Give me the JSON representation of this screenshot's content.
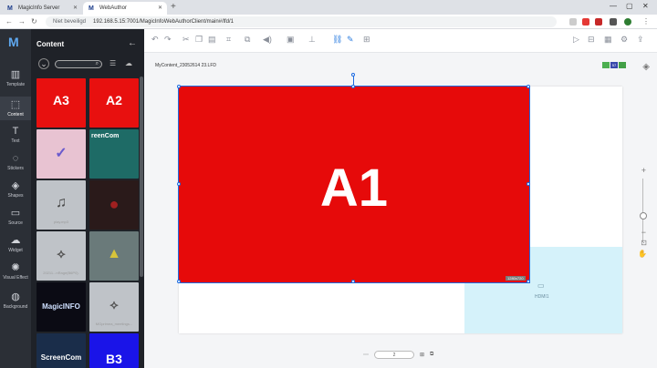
{
  "browser": {
    "tabs": [
      {
        "title": "MagicInfo Server"
      },
      {
        "title": "WebAuthor"
      }
    ],
    "new_tab": "+",
    "security": "Niet beveiligd",
    "url": "192.168.5.15:7001/MagicInfoWebAuthorClient/main#/lfd/1"
  },
  "rail": {
    "items": [
      {
        "label": "Template",
        "icon": "template-icon"
      },
      {
        "label": "Content",
        "icon": "content-icon"
      },
      {
        "label": "Text",
        "icon": "text-icon"
      },
      {
        "label": "Stickers",
        "icon": "sticker-icon"
      },
      {
        "label": "Shapes",
        "icon": "shapes-icon"
      },
      {
        "label": "Source",
        "icon": "source-icon"
      },
      {
        "label": "Widget",
        "icon": "widget-icon"
      },
      {
        "label": "Visual Effect",
        "icon": "effect-icon"
      },
      {
        "label": "Background",
        "icon": "background-icon"
      }
    ]
  },
  "panel": {
    "title": "Content",
    "thumbs": [
      {
        "name": "A3",
        "caption": "",
        "color": "#e8100f"
      },
      {
        "name": "A2",
        "caption": "",
        "color": "#e8100f"
      },
      {
        "name": "",
        "caption": "",
        "color": "#e8c3d2"
      },
      {
        "name": "reenCom",
        "caption": "",
        "color": "#1e6b66"
      },
      {
        "name": "",
        "caption": "play.mp3",
        "color": "#bfc3c8"
      },
      {
        "name": "",
        "caption": "",
        "color": "#2a1a1a"
      },
      {
        "name": "",
        "caption": "20211...nRage(B6P0).",
        "color": "#bfc3c8"
      },
      {
        "name": "",
        "caption": "",
        "color": "#6a7a7a"
      },
      {
        "name": "MagicINFO",
        "caption": "",
        "color": "#0b0b14"
      },
      {
        "name": "",
        "caption": "MGprimea_meetings...",
        "color": "#bfc3c8"
      },
      {
        "name": "ScreenCom",
        "caption": "",
        "color": "#1a2d4a"
      },
      {
        "name": "B3",
        "caption": "",
        "color": "#1a14e8"
      }
    ]
  },
  "work": {
    "filename": "MyContent_23052614 23.LFD",
    "badges": [
      {
        "text": "",
        "color": "#4caf50"
      },
      {
        "text": "57",
        "color": "#3949ab"
      },
      {
        "text": "",
        "color": "#43a047"
      }
    ],
    "a1_label": "A1",
    "size_tag": "1280x720",
    "hdmi_label": "HDMI1",
    "page": "2"
  }
}
